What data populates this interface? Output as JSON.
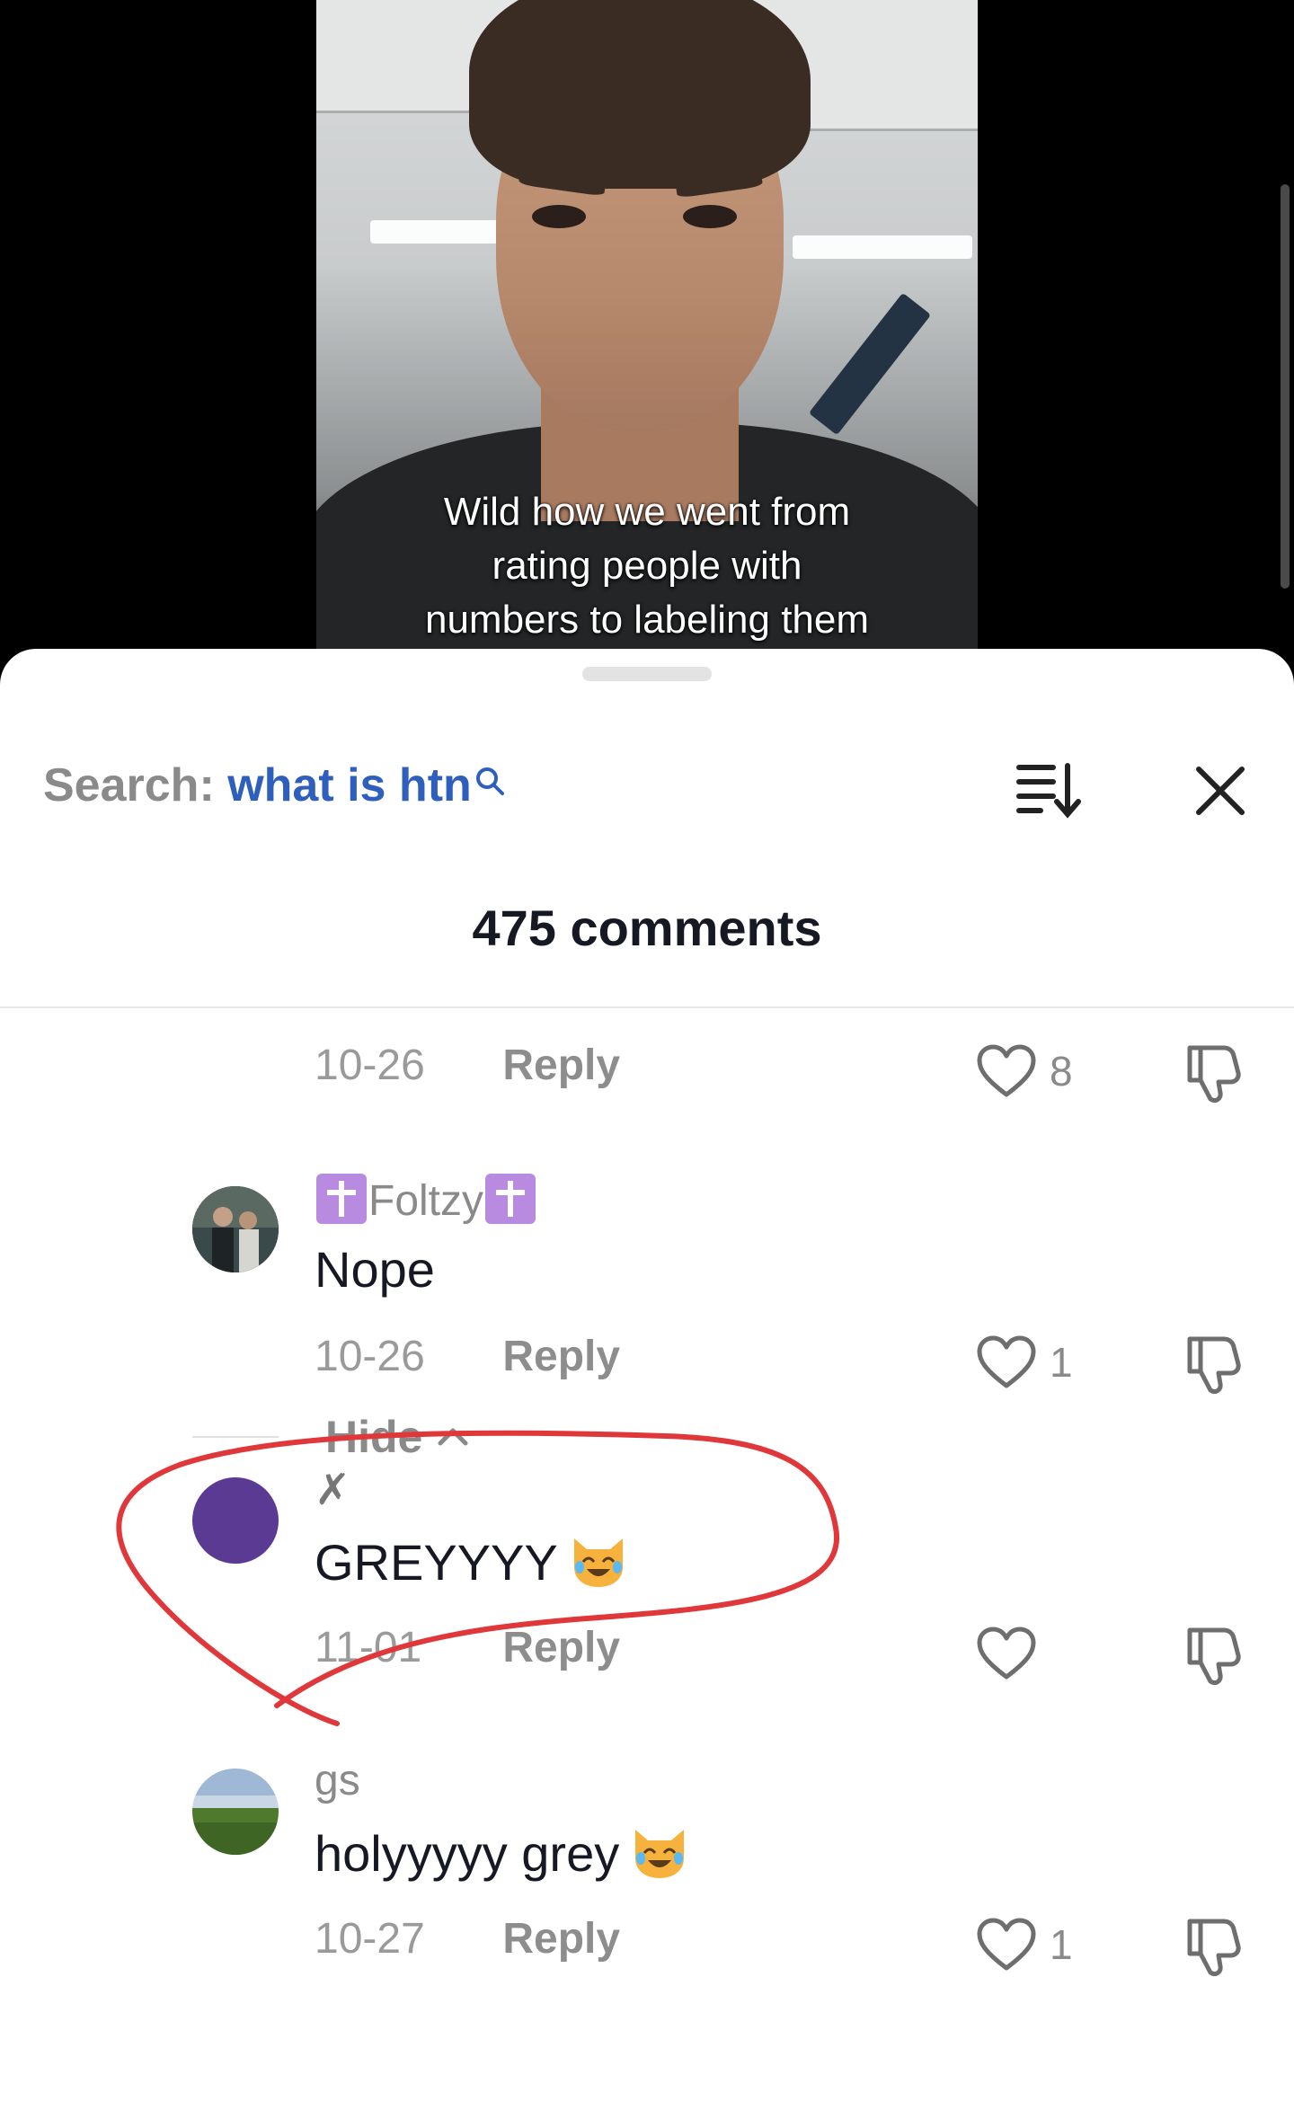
{
  "video": {
    "caption": "Wild how we went from\nrating people with\nnumbers to labeling them"
  },
  "sheet": {
    "search_label": "Search:",
    "search_query": "what is htn",
    "comment_count": "475 comments"
  },
  "comments": [
    {
      "date": "10-26",
      "reply_label": "Reply",
      "likes": "8"
    },
    {
      "username": "Foltzy",
      "text": "Nope",
      "date": "10-26",
      "reply_label": "Reply",
      "likes": "1"
    },
    {
      "username": "✗",
      "text": "GREYYYY",
      "date": "11-01",
      "reply_label": "Reply",
      "likes": ""
    },
    {
      "username": "gs",
      "text": "holyyyyy grey",
      "date": "10-27",
      "reply_label": "Reply",
      "likes": "1"
    }
  ],
  "footer": {
    "hide_label": "Hide"
  },
  "colors": {
    "search_query": "#2e5fbd",
    "annotation_circle": "#e0383a",
    "avatar_purple": "#5b3a94"
  }
}
